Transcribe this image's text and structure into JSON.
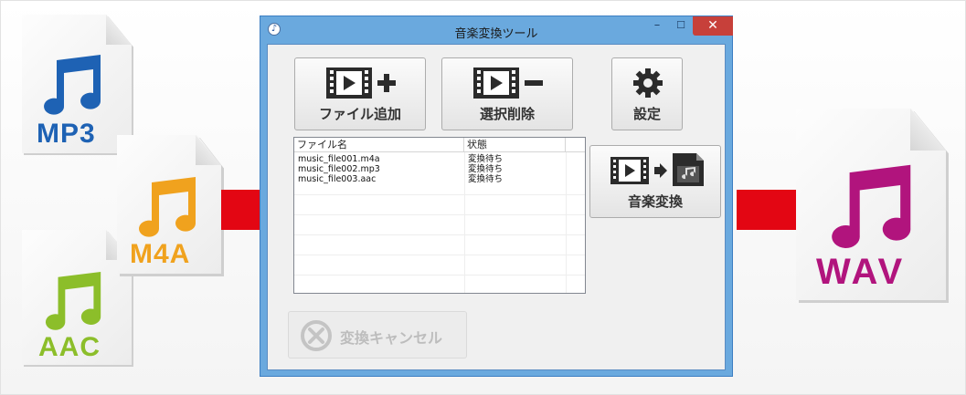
{
  "sources": [
    {
      "format": "MP3",
      "color": "#1e62b4"
    },
    {
      "format": "M4A",
      "color": "#f0a21e"
    },
    {
      "format": "AAC",
      "color": "#8cbe2a"
    }
  ],
  "target": {
    "format": "WAV",
    "color": "#b1147d"
  },
  "arrow_color": "#e30613",
  "window": {
    "title": "音楽変換ツール",
    "controls": {
      "minimize": "–",
      "maximize": "☐",
      "close": "✕"
    }
  },
  "toolbar": {
    "add_file": "ファイル追加",
    "delete_selected": "選択削除",
    "settings": "設定",
    "convert": "音楽変換",
    "cancel": "変換キャンセル"
  },
  "file_list": {
    "columns": [
      "ファイル名",
      "状態"
    ],
    "rows": [
      {
        "name": "music_file001.m4a",
        "status": "変換待ち"
      },
      {
        "name": "music_file002.mp3",
        "status": "変換待ち"
      },
      {
        "name": "music_file003.aac",
        "status": "変換待ち"
      }
    ]
  }
}
